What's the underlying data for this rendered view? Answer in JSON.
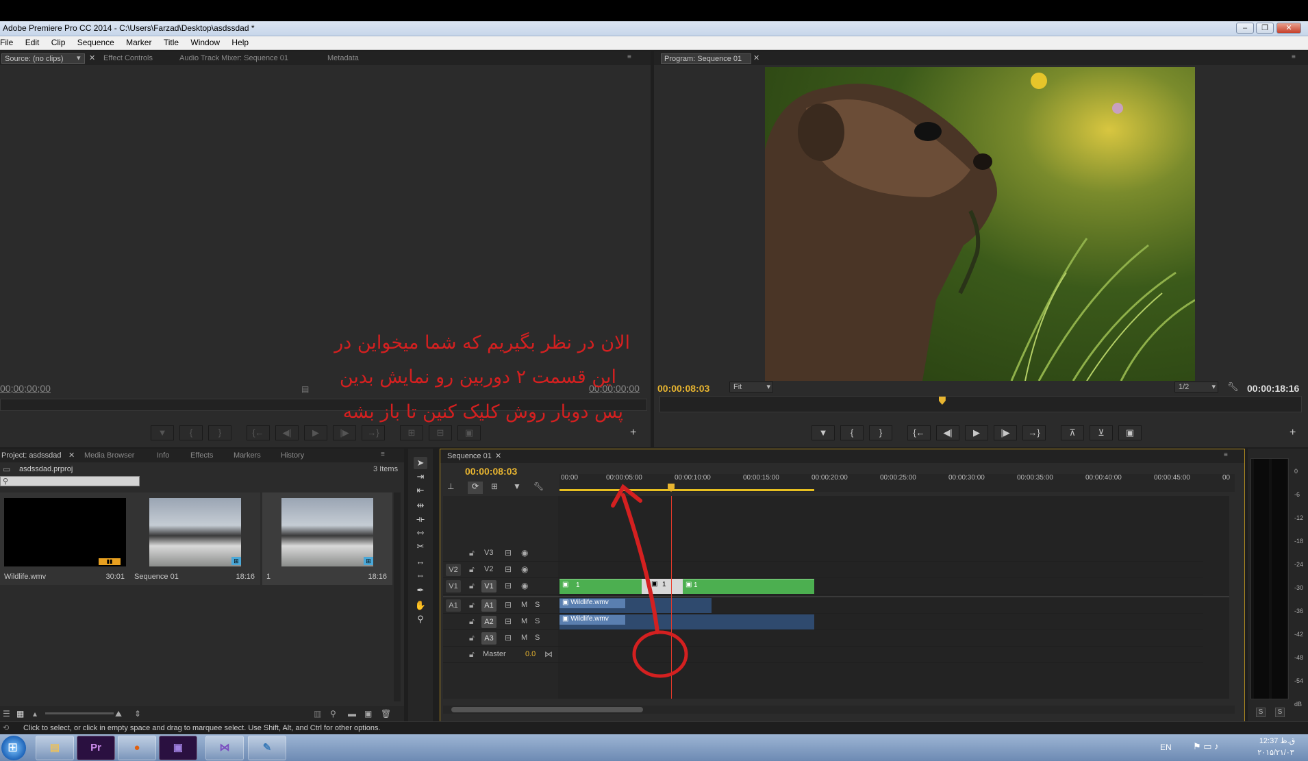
{
  "window": {
    "title": "Adobe Premiere Pro CC 2014 - C:\\Users\\Farzad\\Desktop\\asdssdad *",
    "buttons": [
      "–",
      "❐",
      "✕"
    ]
  },
  "menu": [
    "File",
    "Edit",
    "Clip",
    "Sequence",
    "Marker",
    "Title",
    "Window",
    "Help"
  ],
  "source_panel": {
    "tabs": [
      "Source: (no clips)",
      "Effect Controls",
      "Audio Track Mixer: Sequence 01",
      "Metadata"
    ],
    "timecode_left": "00;00;00;00",
    "timecode_right": "00;00;00;00"
  },
  "program_panel": {
    "tab": "Program: Sequence 01",
    "timecode": "00:00:08:03",
    "fit_label": "Fit",
    "resolution": "1/2",
    "duration": "00:00:18:16",
    "playhead_fraction": 0.44
  },
  "annotation": {
    "line1": "الان در نظر بگیریم که شما میخواین در",
    "line2": "این قسمت ۲ دوربین رو نمایش بدین",
    "line3": "پس دوبار روش کلیک کنین تا باز بشه",
    "color": "#d42020"
  },
  "project_panel": {
    "tabs": [
      "Project: asdssdad",
      "Media Browser",
      "Info",
      "Effects",
      "Markers",
      "History"
    ],
    "file": "asdssdad.prproj",
    "count": "3 Items",
    "items": [
      {
        "name": "Wildlife.wmv",
        "duration": "30:01"
      },
      {
        "name": "Sequence 01",
        "duration": "18:16"
      },
      {
        "name": "1",
        "duration": "18:16"
      }
    ]
  },
  "timeline": {
    "tab": "Sequence 01",
    "timecode": "00:00:08:03",
    "ruler": [
      "00:00",
      "00:00:05:00",
      "00:00:10:00",
      "00:00:15:00",
      "00:00:20:00",
      "00:00:25:00",
      "00:00:30:00",
      "00:00:35:00",
      "00:00:40:00",
      "00:00:45:00",
      "00"
    ],
    "tracks": {
      "video": [
        "V3",
        "V2",
        "V1"
      ],
      "audio": [
        "A1",
        "A2",
        "A3"
      ],
      "source_video": "V2",
      "source_video_v1": "V1",
      "source_audio": "A1",
      "master_label": "Master",
      "master_value": "0.0",
      "mute": "M",
      "solo": "S"
    },
    "clips": {
      "v1_a": "1",
      "v1_b": "1",
      "v1_c": "1",
      "a1": "Wildlife.wmv",
      "a2": "Wildlife.wmv"
    }
  },
  "meter": {
    "labels": [
      "0",
      "-6",
      "-12",
      "-18",
      "-24",
      "-30",
      "-36",
      "-42",
      "-48",
      "-54",
      "dB"
    ],
    "solo_left": "S",
    "solo_right": "S"
  },
  "status": "Click to select, or click in empty space and drag to marquee select. Use Shift, Alt, and Ctrl for other options.",
  "taskbar": {
    "apps": [
      "Pr",
      "",
      "",
      "",
      "",
      ""
    ],
    "lang": "EN",
    "time": "12:37 ق.ظ",
    "date": "۲۰۱۵/۲۱/۰۳"
  },
  "colors": {
    "accent": "#e8b530",
    "clip_green": "#4caf50",
    "audio_clip": "#2f4a6e",
    "playhead": "#e83a2a"
  }
}
